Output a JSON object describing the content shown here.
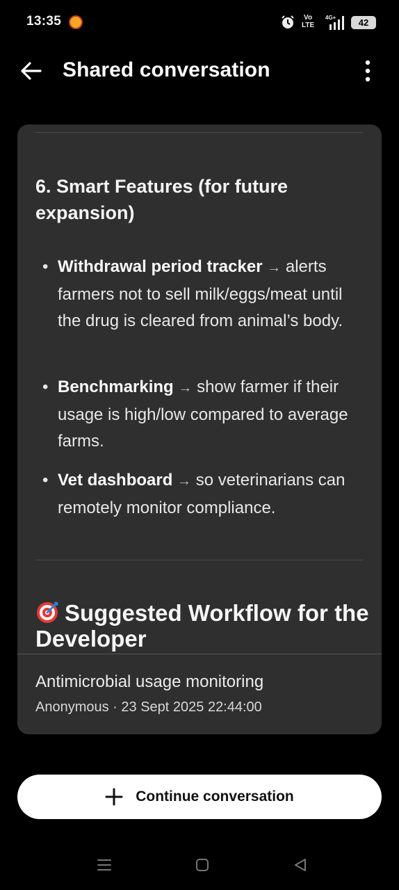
{
  "status_bar": {
    "time": "13:35",
    "volte_top": "Vo",
    "volte_bottom": "LTE",
    "network": "4G+",
    "battery": "42",
    "icons": [
      "app-notification-icon",
      "alarm-icon",
      "volte-icon",
      "signal-icon",
      "battery-icon"
    ]
  },
  "app_bar": {
    "title": "Shared conversation",
    "back_icon": "arrow-left-icon",
    "menu_icon": "more-vertical-icon"
  },
  "content": {
    "section_heading": "6. Smart Features (for future expansion)",
    "bullets": [
      {
        "bold": "Withdrawal period tracker",
        "arrow": "→",
        "text": "alerts farmers not to sell milk/eggs/meat until the drug is cleared from animal’s body."
      },
      {
        "bold": "Benchmarking",
        "arrow": "→",
        "text": "show farmer if their usage is high/low compared to average farms."
      },
      {
        "bold": "Vet dashboard",
        "arrow": "→",
        "text": "so veterinarians can remotely monitor compliance."
      }
    ],
    "workflow_heading": "Suggested Workflow for the Developer",
    "workflow_icon": "target-icon"
  },
  "conversation": {
    "title": "Antimicrobial usage monitoring",
    "meta": "Anonymous · 23 Sept 2025 22:44:00"
  },
  "actions": {
    "continue_label": "Continue conversation",
    "continue_icon": "plus-icon"
  },
  "nav": {
    "icons": [
      "recents-icon",
      "home-icon",
      "back-triangle-icon"
    ]
  },
  "colors": {
    "background": "#000000",
    "card": "#2f2f2f",
    "button": "#ffffff",
    "text": "#ffffff"
  }
}
